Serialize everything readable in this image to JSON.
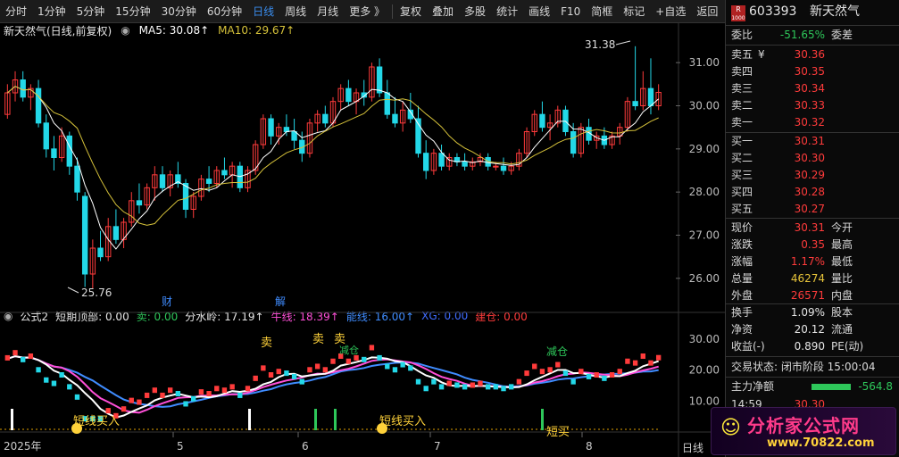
{
  "toolbar": {
    "items": [
      "分时",
      "1分钟",
      "5分钟",
      "15分钟",
      "30分钟",
      "60分钟",
      "日线",
      "周线",
      "月线",
      "更多 》"
    ],
    "active_index": 6,
    "right_items": [
      "复权",
      "叠加",
      "多股",
      "统计",
      "画线",
      "F10",
      "简框",
      "标记",
      "+自选",
      "返回"
    ]
  },
  "main_info": {
    "title": "新天然气(日线,前复权)",
    "ma5": "MA5: 30.08↑",
    "ma10": "MA10: 29.67↑"
  },
  "sub_info": {
    "formula": "公式2",
    "top_label": "短期顶部: 0.00",
    "sell": "卖: 0.00",
    "divide": "分水岭: 17.19↑",
    "bull": "牛线: 18.39↑",
    "energy": "能线: 16.00↑",
    "xg": "XG: 0.00",
    "build": "建仓: 0.00"
  },
  "price_axis": [
    "31.00",
    "30.00",
    "29.00",
    "28.00",
    "27.00",
    "26.00"
  ],
  "sub_axis": [
    "30.00",
    "20.00",
    "10.00"
  ],
  "date_axis": [
    "2025年",
    "5",
    "6",
    "7",
    "8"
  ],
  "bottom_right": "日线",
  "annotations": {
    "high": "31.38",
    "low": "25.76",
    "cai": "财",
    "jie": "解",
    "buy1": "短线买入",
    "buy2": "短线买入",
    "sell_mark": "卖",
    "reduce1": "减仓",
    "reduce2": "减仓",
    "short_buy": "短买"
  },
  "panel": {
    "code": "603393",
    "name": "新天然气",
    "badge_r": "R",
    "badge_num": "1000",
    "weibi_label": "委比",
    "weibi_value": "-51.65%",
    "weicha_label": "委差",
    "asks": [
      {
        "label": "卖五",
        "value": "30.36"
      },
      {
        "label": "卖四",
        "value": "30.35"
      },
      {
        "label": "卖三",
        "value": "30.34"
      },
      {
        "label": "卖二",
        "value": "30.33"
      },
      {
        "label": "卖一",
        "value": "30.32"
      }
    ],
    "ask_currency": "¥",
    "bids": [
      {
        "label": "买一",
        "value": "30.31"
      },
      {
        "label": "买二",
        "value": "30.30"
      },
      {
        "label": "买三",
        "value": "30.29"
      },
      {
        "label": "买四",
        "value": "30.28"
      },
      {
        "label": "买五",
        "value": "30.27"
      }
    ],
    "stats": [
      {
        "l1": "现价",
        "v1": "30.31",
        "c1": "red",
        "l2": "今开",
        "v2": "",
        "c2": "red"
      },
      {
        "l1": "涨跌",
        "v1": "0.35",
        "c1": "red",
        "l2": "最高",
        "v2": "",
        "c2": "red"
      },
      {
        "l1": "涨幅",
        "v1": "1.17%",
        "c1": "red",
        "l2": "最低",
        "v2": "",
        "c2": "red"
      },
      {
        "l1": "总量",
        "v1": "46274",
        "c1": "yellow",
        "l2": "量比",
        "v2": "",
        "c2": "white"
      },
      {
        "l1": "外盘",
        "v1": "26571",
        "c1": "red",
        "l2": "内盘",
        "v2": "",
        "c2": "green"
      }
    ],
    "stats2": [
      {
        "l1": "换手",
        "v1": "1.09%",
        "l2": "股本"
      },
      {
        "l1": "净资",
        "v1": "20.12",
        "l2": "流通"
      },
      {
        "l1": "收益(-)",
        "v1": "0.890",
        "l2": "PE(动)"
      }
    ],
    "trade_status": "交易状态: 闭市阶段 15:00:04",
    "main_flow_label": "主力净额",
    "main_flow_value": "-564.8",
    "tick_time": "14:59",
    "tick_price": "30.30"
  },
  "watermark": {
    "title": "分析家公式网",
    "url": "www.70822.com"
  },
  "colors": {
    "up": "#ff3b3b",
    "down": "#23d8e8",
    "ma5": "#ffffff",
    "ma10": "#d6c23a",
    "active": "#3a8ef0"
  },
  "chart_data": {
    "type": "candlestick",
    "ylim": [
      25.5,
      31.5
    ],
    "candles": [
      [
        29.8,
        30.5,
        29.7,
        30.3
      ],
      [
        30.3,
        30.8,
        30.1,
        30.6
      ],
      [
        30.6,
        30.8,
        30.1,
        30.2
      ],
      [
        30.2,
        30.5,
        29.9,
        30.4
      ],
      [
        30.4,
        30.6,
        29.5,
        29.6
      ],
      [
        29.6,
        29.8,
        28.8,
        29.0
      ],
      [
        29.0,
        29.3,
        28.5,
        28.8
      ],
      [
        28.8,
        29.5,
        28.7,
        29.3
      ],
      [
        29.3,
        29.4,
        28.4,
        28.6
      ],
      [
        28.6,
        28.8,
        27.8,
        28.0
      ],
      [
        27.9,
        28.0,
        25.8,
        26.1
      ],
      [
        26.1,
        26.9,
        25.76,
        26.7
      ],
      [
        26.7,
        27.1,
        26.4,
        26.5
      ],
      [
        26.5,
        27.4,
        26.4,
        27.2
      ],
      [
        27.2,
        27.6,
        26.8,
        26.9
      ],
      [
        26.9,
        27.4,
        26.7,
        27.3
      ],
      [
        27.3,
        28.0,
        27.2,
        27.8
      ],
      [
        27.8,
        28.2,
        27.5,
        27.7
      ],
      [
        27.7,
        28.2,
        27.6,
        28.1
      ],
      [
        28.1,
        28.6,
        27.8,
        28.4
      ],
      [
        28.4,
        28.6,
        28.0,
        28.1
      ],
      [
        28.1,
        28.5,
        27.9,
        28.4
      ],
      [
        28.4,
        28.7,
        28.1,
        28.2
      ],
      [
        28.2,
        28.3,
        27.4,
        27.6
      ],
      [
        27.6,
        28.0,
        27.4,
        27.9
      ],
      [
        27.9,
        28.4,
        27.8,
        28.3
      ],
      [
        28.3,
        28.6,
        28.0,
        28.2
      ],
      [
        28.2,
        28.6,
        28.1,
        28.5
      ],
      [
        28.5,
        28.8,
        28.3,
        28.4
      ],
      [
        28.4,
        28.7,
        28.1,
        28.6
      ],
      [
        28.6,
        28.7,
        28.0,
        28.1
      ],
      [
        28.1,
        28.6,
        28.0,
        28.5
      ],
      [
        28.5,
        29.2,
        28.4,
        29.1
      ],
      [
        29.1,
        29.8,
        29.0,
        29.7
      ],
      [
        29.7,
        29.8,
        29.1,
        29.3
      ],
      [
        29.3,
        29.6,
        29.1,
        29.5
      ],
      [
        29.5,
        29.8,
        29.3,
        29.4
      ],
      [
        29.4,
        29.7,
        29.0,
        29.2
      ],
      [
        29.2,
        29.4,
        28.7,
        28.9
      ],
      [
        28.9,
        29.7,
        28.8,
        29.6
      ],
      [
        29.6,
        29.9,
        29.4,
        29.8
      ],
      [
        29.8,
        30.0,
        29.5,
        29.6
      ],
      [
        29.6,
        30.2,
        29.5,
        30.1
      ],
      [
        30.1,
        30.5,
        29.9,
        30.4
      ],
      [
        30.4,
        30.6,
        30.0,
        30.1
      ],
      [
        30.1,
        30.4,
        29.8,
        30.3
      ],
      [
        30.3,
        30.6,
        30.0,
        30.2
      ],
      [
        30.2,
        31.0,
        30.1,
        30.9
      ],
      [
        30.9,
        31.1,
        30.2,
        30.3
      ],
      [
        30.3,
        30.6,
        29.7,
        29.8
      ],
      [
        29.8,
        30.2,
        29.5,
        29.6
      ],
      [
        29.6,
        30.1,
        29.4,
        29.9
      ],
      [
        29.9,
        30.3,
        29.6,
        29.7
      ],
      [
        29.7,
        30.0,
        28.8,
        28.9
      ],
      [
        28.9,
        29.2,
        28.3,
        28.5
      ],
      [
        28.5,
        29.0,
        28.4,
        28.9
      ],
      [
        28.9,
        29.1,
        28.5,
        28.6
      ],
      [
        28.6,
        28.9,
        28.5,
        28.8
      ],
      [
        28.8,
        28.9,
        28.6,
        28.7
      ],
      [
        28.7,
        28.9,
        28.5,
        28.6
      ],
      [
        28.6,
        28.8,
        28.5,
        28.7
      ],
      [
        28.7,
        28.9,
        28.6,
        28.8
      ],
      [
        28.8,
        28.9,
        28.5,
        28.6
      ],
      [
        28.6,
        28.7,
        28.5,
        28.6
      ],
      [
        28.6,
        28.8,
        28.4,
        28.5
      ],
      [
        28.5,
        28.7,
        28.4,
        28.6
      ],
      [
        28.6,
        29.0,
        28.5,
        28.9
      ],
      [
        28.9,
        29.5,
        28.8,
        29.4
      ],
      [
        29.4,
        29.9,
        29.3,
        29.8
      ],
      [
        29.8,
        30.1,
        29.4,
        29.5
      ],
      [
        29.5,
        29.8,
        29.2,
        29.6
      ],
      [
        29.6,
        30.0,
        29.5,
        29.9
      ],
      [
        29.9,
        30.0,
        29.3,
        29.4
      ],
      [
        29.4,
        29.6,
        28.8,
        28.9
      ],
      [
        28.9,
        29.6,
        28.8,
        29.5
      ],
      [
        29.5,
        29.7,
        29.1,
        29.2
      ],
      [
        29.2,
        29.4,
        29.0,
        29.3
      ],
      [
        29.3,
        29.5,
        29.0,
        29.1
      ],
      [
        29.1,
        29.4,
        29.0,
        29.3
      ],
      [
        29.3,
        29.6,
        29.1,
        29.5
      ],
      [
        29.5,
        30.2,
        29.4,
        30.1
      ],
      [
        30.1,
        31.38,
        29.9,
        30.0
      ],
      [
        30.0,
        30.8,
        29.9,
        30.4
      ],
      [
        30.4,
        31.1,
        29.8,
        30.0
      ],
      [
        30.0,
        30.5,
        29.9,
        30.31
      ]
    ]
  }
}
